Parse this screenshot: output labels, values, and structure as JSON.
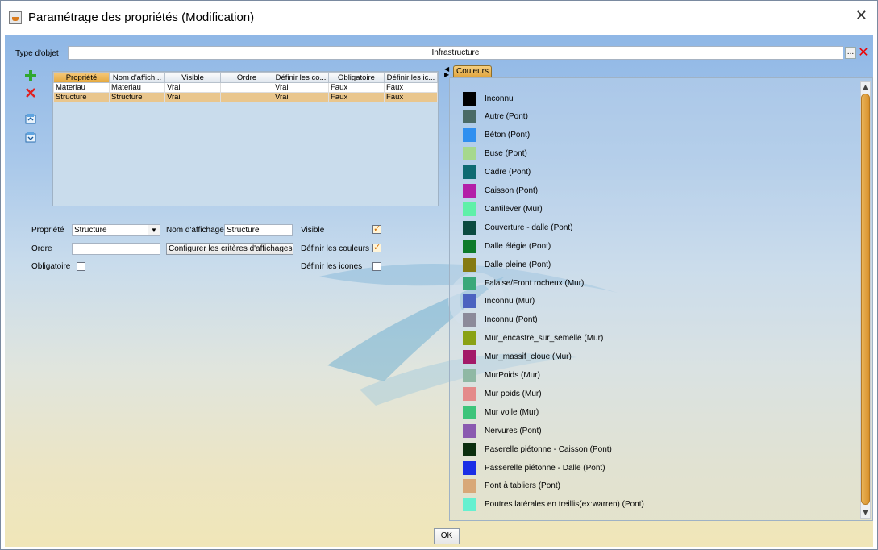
{
  "window": {
    "title": "Paramétrage des propriétés (Modification)"
  },
  "type_objet": {
    "label": "Type d'objet",
    "value": "Infrastructure",
    "browse": "..."
  },
  "grid": {
    "headers": [
      "Propriété",
      "Nom d'affich...",
      "Visible",
      "Ordre",
      "Définir les co...",
      "Obligatoire",
      "Définir les ic..."
    ],
    "rows": [
      [
        "Materiau",
        "Materiau",
        "Vrai",
        "",
        "Vrai",
        "Faux",
        "Faux"
      ],
      [
        "Structure",
        "Structure",
        "Vrai",
        "",
        "Vrai",
        "Faux",
        "Faux"
      ]
    ],
    "selected_row": 1
  },
  "form": {
    "propriete_label": "Propriété",
    "propriete_value": "Structure",
    "nom_affichage_label": "Nom d'affichage",
    "nom_affichage_value": "Structure",
    "visible_label": "Visible",
    "ordre_label": "Ordre",
    "ordre_value": "",
    "configurer_button": "Configurer les critères d'affichages",
    "definir_couleurs_label": "Définir les couleurs",
    "obligatoire_label": "Obligatoire",
    "definir_icones_label": "Définir les icones",
    "visible_checked": true,
    "definir_couleurs_checked": true,
    "obligatoire_checked": false,
    "definir_icones_checked": false
  },
  "colors_tab": {
    "label": "Couleurs"
  },
  "colors": [
    {
      "label": "Inconnu",
      "color": "#000000"
    },
    {
      "label": "Autre (Pont)",
      "color": "#4a6a66"
    },
    {
      "label": "Béton (Pont)",
      "color": "#2f8ff0"
    },
    {
      "label": "Buse (Pont)",
      "color": "#a6d88e"
    },
    {
      "label": "Cadre (Pont)",
      "color": "#0e6a72"
    },
    {
      "label": "Caisson (Pont)",
      "color": "#b31fa8"
    },
    {
      "label": "Cantilever (Mur)",
      "color": "#5ff0a8"
    },
    {
      "label": "Couverture - dalle (Pont)",
      "color": "#0b4a40"
    },
    {
      "label": "Dalle élégie (Pont)",
      "color": "#0d7a2a"
    },
    {
      "label": "Dalle pleine (Pont)",
      "color": "#857a13"
    },
    {
      "label": "Falaise/Front rocheux (Mur)",
      "color": "#3aa87a"
    },
    {
      "label": "Inconnu (Mur)",
      "color": "#4b63c0"
    },
    {
      "label": "Inconnu (Pont)",
      "color": "#8c8a9a"
    },
    {
      "label": "Mur_encastre_sur_semelle (Mur)",
      "color": "#8aa214"
    },
    {
      "label": "Mur_massif_cloue (Mur)",
      "color": "#a31a68"
    },
    {
      "label": "MurPoids (Mur)",
      "color": "#8fb8a4"
    },
    {
      "label": "Mur poids (Mur)",
      "color": "#e48a8a"
    },
    {
      "label": "Mur voile (Mur)",
      "color": "#3dc47a"
    },
    {
      "label": "Nervures (Pont)",
      "color": "#8a5ab0"
    },
    {
      "label": "Paserelle piétonne - Caisson (Pont)",
      "color": "#0b2e0e"
    },
    {
      "label": "Passerelle piétonne - Dalle (Pont)",
      "color": "#1a2ee6"
    },
    {
      "label": "Pont à tabliers (Pont)",
      "color": "#d8a878"
    },
    {
      "label": "Poutres latérales en treillis(ex:warren) (Pont)",
      "color": "#66f0d0"
    }
  ],
  "footer": {
    "ok_label": "OK"
  }
}
